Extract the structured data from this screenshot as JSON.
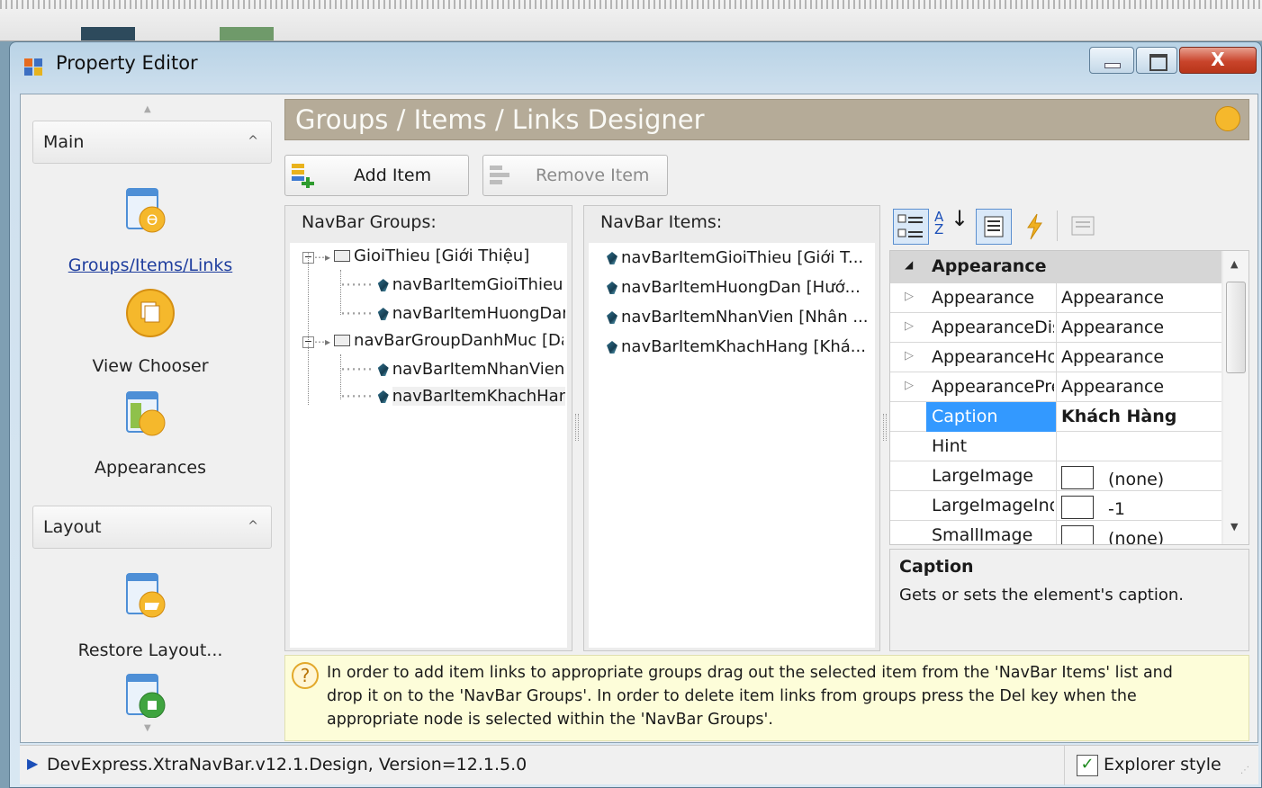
{
  "window": {
    "title": "Property Editor"
  },
  "sidebar": {
    "sections": [
      {
        "label": "Main"
      },
      {
        "label": "Layout"
      }
    ],
    "items": [
      {
        "label": "Groups/Items/Links",
        "icon": "groups-items-links-icon"
      },
      {
        "label": "View Chooser",
        "icon": "view-chooser-icon"
      },
      {
        "label": "Appearances",
        "icon": "appearances-icon"
      },
      {
        "label": "Restore Layout...",
        "icon": "restore-layout-icon"
      }
    ]
  },
  "designer": {
    "title": "Groups / Items / Links Designer",
    "add_item": "Add Item",
    "remove_item": "Remove Item"
  },
  "groups_panel": {
    "header": "NavBar Groups:",
    "groups": [
      {
        "label": "GioiThieu [Giới Thiệu]",
        "items": [
          "navBarItemGioiThieu [",
          "navBarItemHuongDan"
        ]
      },
      {
        "label": "navBarGroupDanhMuc [Da",
        "items": [
          "navBarItemNhanVien [",
          "navBarItemKhachHang"
        ]
      }
    ]
  },
  "items_panel": {
    "header": "NavBar Items:",
    "items": [
      "navBarItemGioiThieu [Giới T...",
      "navBarItemHuongDan [Hướ...",
      "navBarItemNhanVien [Nhân ...",
      "navBarItemKhachHang [Khá..."
    ]
  },
  "property_grid": {
    "category": "Appearance",
    "rows": [
      {
        "name": "Appearance",
        "value": "Appearance",
        "expandable": true
      },
      {
        "name": "AppearanceDis",
        "value": "Appearance",
        "expandable": true
      },
      {
        "name": "AppearanceHot",
        "value": "Appearance",
        "expandable": true
      },
      {
        "name": "AppearancePre",
        "value": "Appearance",
        "expandable": true
      },
      {
        "name": "Caption",
        "value": "Khách Hàng",
        "selected": true
      },
      {
        "name": "Hint",
        "value": ""
      },
      {
        "name": "LargeImage",
        "value": "(none)",
        "swatch": true
      },
      {
        "name": "LargeImageInd",
        "value": "-1",
        "swatch": true
      },
      {
        "name": "SmallImage",
        "value": "(none)",
        "swatch": true
      }
    ],
    "description_title": "Caption",
    "description_text": "Gets or sets the element's caption."
  },
  "info": {
    "line1": "In order to add item links to appropriate groups drag out the selected item from the 'NavBar Items' list and",
    "line2": "drop it on to the 'NavBar Groups'. In order to delete item links from groups press the Del key when the",
    "line3": "appropriate node is selected within the 'NavBar Groups'."
  },
  "status": {
    "version": "DevExpress.XtraNavBar.v12.1.Design, Version=12.1.5.0",
    "explorer_style": "Explorer style",
    "explorer_checked": true
  },
  "colors": {
    "selection": "#3399ff",
    "header_bg": "#b5ab98",
    "info_bg": "#fdfdd9"
  }
}
